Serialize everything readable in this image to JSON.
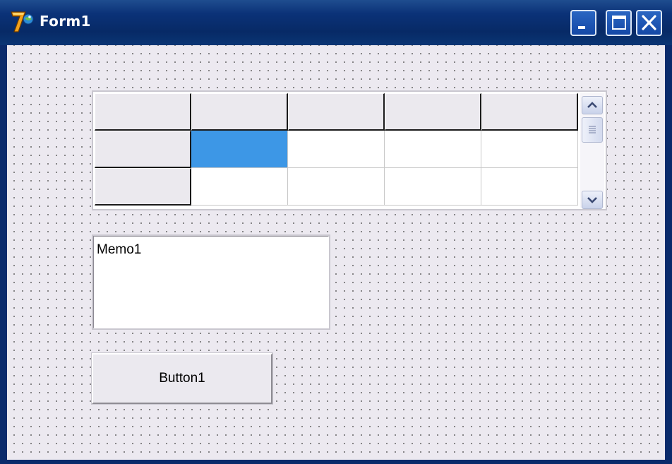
{
  "window": {
    "title": "Form1",
    "app_icon": "delphi-7-icon",
    "caption_buttons": [
      "minimize-icon",
      "maximize-icon",
      "close-icon"
    ]
  },
  "colors": {
    "titlebar": "#0b3278",
    "form_background": "#ece9f0",
    "grid_dots": "#6b6b6b",
    "selected_cell": "#3d97e6",
    "fixed_cell": "#ebe9ee"
  },
  "string_grid": {
    "columns": 5,
    "visible_rows": 3,
    "fixed_cols": 1,
    "fixed_rows": 1,
    "selected_cell": {
      "row": 1,
      "col": 1
    },
    "cells": [
      [
        "",
        "",
        "",
        "",
        ""
      ],
      [
        "",
        "",
        "",
        "",
        ""
      ],
      [
        "",
        "",
        "",
        "",
        ""
      ]
    ],
    "scrollbar_icons": [
      "scroll-up-icon",
      "scroll-thumb-grip-icon",
      "scroll-down-icon"
    ]
  },
  "memo": {
    "text": "Memo1"
  },
  "button": {
    "label": "Button1"
  }
}
